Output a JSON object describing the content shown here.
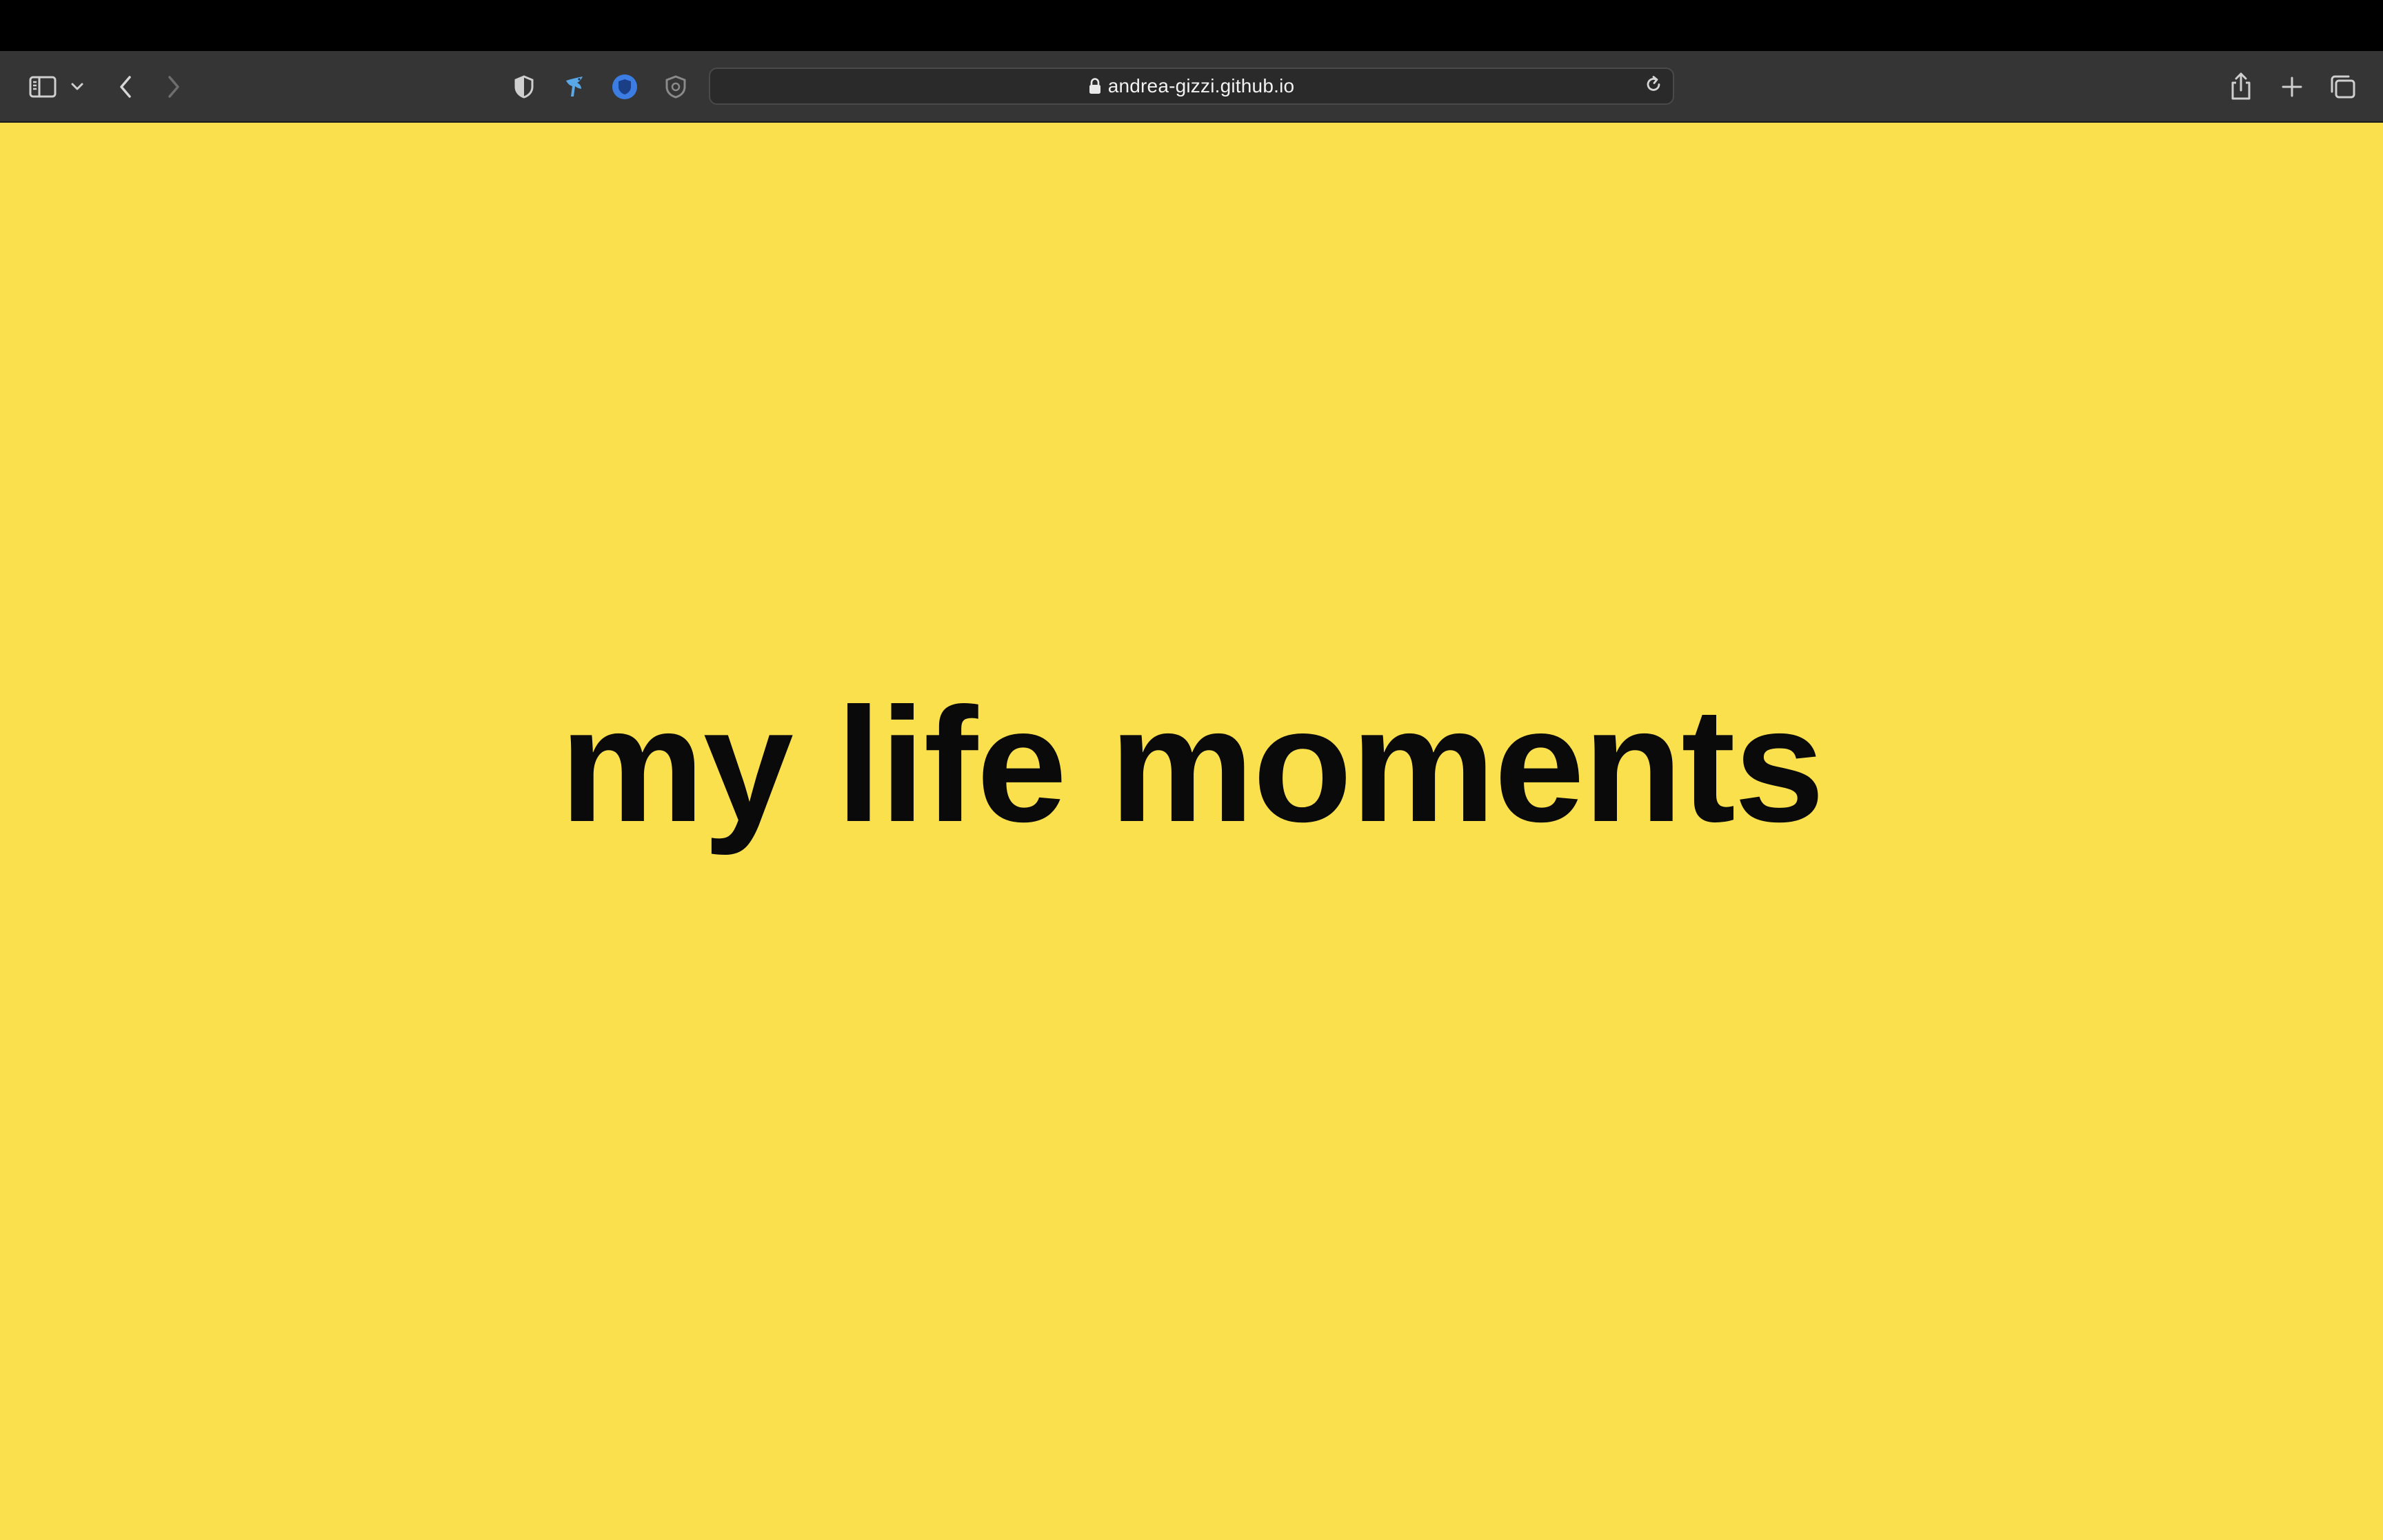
{
  "browser": {
    "url": "andrea-gizzi.github.io",
    "toolbar_color": "#353535",
    "icons": {
      "sidebar": "sidebar-toggle-icon",
      "sidebar_menu": "chevron-down-icon",
      "back": "chevron-left-icon",
      "forward": "chevron-right-icon",
      "privacy": "half-shield-icon",
      "extension_1": "bird-extension-icon",
      "extension_2": "blue-shield-extension-icon",
      "extension_3": "gray-shield-extension-icon",
      "lock": "lock-icon",
      "reload": "reload-icon",
      "share": "share-icon",
      "new_tab": "plus-icon",
      "tab_overview": "tabs-overview-icon"
    }
  },
  "page": {
    "background_color": "#FBE04D",
    "title": "my life moments",
    "title_color": "#0a0a0a"
  }
}
